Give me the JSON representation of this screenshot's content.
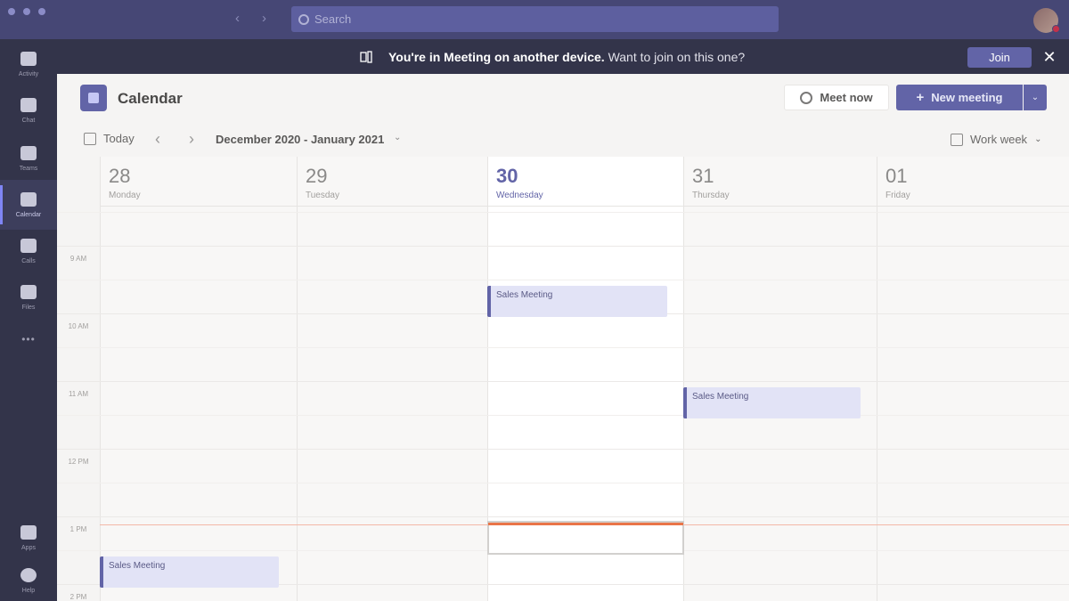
{
  "titlebar": {
    "search_placeholder": "Search"
  },
  "rail": {
    "items": [
      {
        "label": "Activity",
        "icon": "bell-icon"
      },
      {
        "label": "Chat",
        "icon": "chat-icon"
      },
      {
        "label": "Teams",
        "icon": "teams-icon"
      },
      {
        "label": "Calendar",
        "icon": "calendar-icon",
        "active": true
      },
      {
        "label": "Calls",
        "icon": "phone-icon"
      },
      {
        "label": "Files",
        "icon": "file-icon"
      }
    ],
    "more": "•••",
    "bottom_items": [
      {
        "label": "Apps",
        "icon": "apps-icon"
      },
      {
        "label": "Help",
        "icon": "help-icon"
      }
    ]
  },
  "banner": {
    "bold_text": "You're in Meeting on another device.",
    "text": "Want to join on this one?",
    "join_label": "Join",
    "close_label": "✕"
  },
  "header": {
    "title": "Calendar",
    "meet_now_label": "Meet now",
    "new_meeting_label": "New meeting",
    "new_meeting_plus": "+",
    "dropdown_caret": "⌄"
  },
  "toolbar": {
    "today_label": "Today",
    "prev": "‹",
    "next": "›",
    "date_range": "December 2020 - January 2021",
    "range_caret": "⌄",
    "view_label": "Work week",
    "view_caret": "⌄"
  },
  "days": [
    {
      "num": "28",
      "name": "Monday"
    },
    {
      "num": "29",
      "name": "Tuesday"
    },
    {
      "num": "30",
      "name": "Wednesday",
      "today": true
    },
    {
      "num": "31",
      "name": "Thursday"
    },
    {
      "num": "01",
      "name": "Friday"
    }
  ],
  "time_labels": [
    "9 AM",
    "10 AM",
    "11 AM",
    "12 PM",
    "1 PM",
    "2 PM"
  ],
  "events": [
    {
      "title": "Sales Meeting",
      "day": 2,
      "start": "10:00"
    },
    {
      "title": "Sales Meeting",
      "day": 3,
      "start": "11:00"
    },
    {
      "title": "Sales Meeting",
      "day": 0,
      "start": "1:30"
    }
  ],
  "colors": {
    "accent": "#6264a7",
    "titlebar": "#464775",
    "rail": "#33344a",
    "event_bg": "#e2e3f6",
    "now_line": "#e97548"
  }
}
